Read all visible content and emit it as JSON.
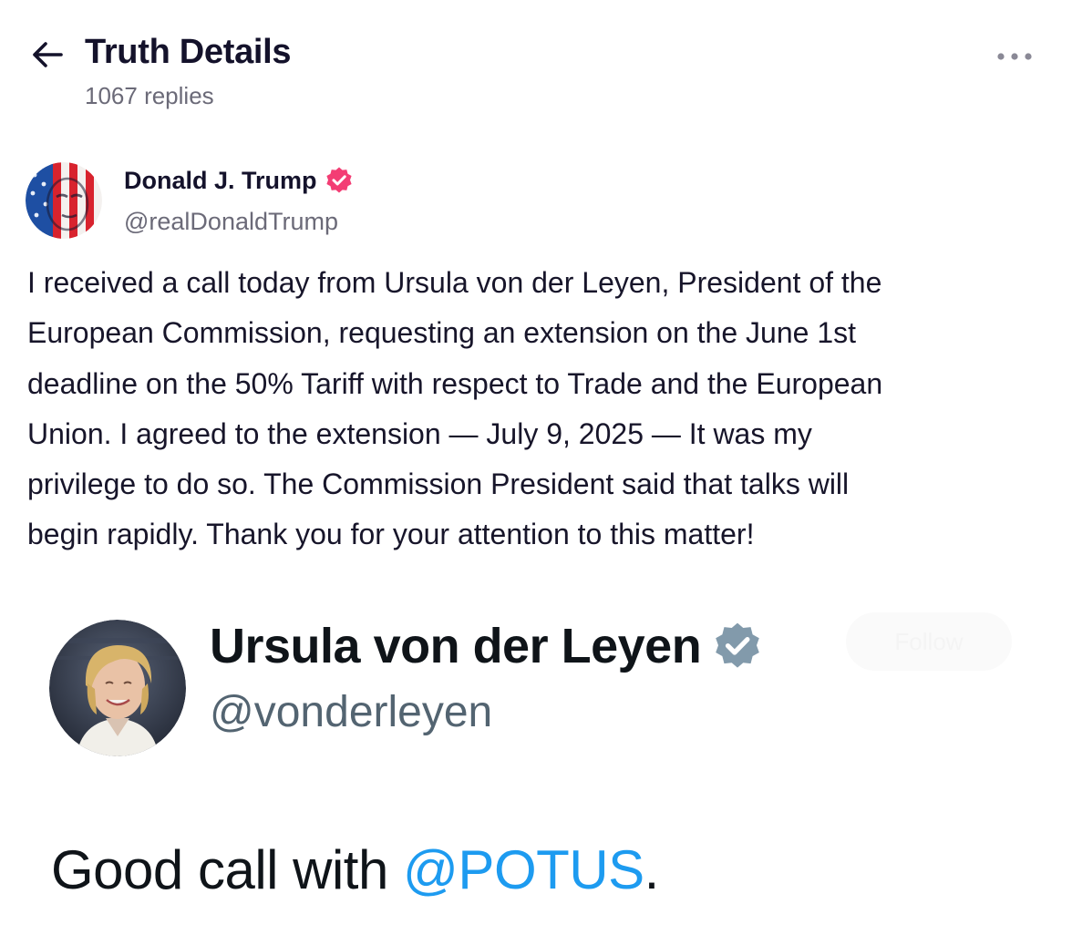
{
  "header": {
    "title": "Truth Details",
    "replies": "1067 replies",
    "back_icon": "arrow-left-icon",
    "more_icon": "more-horizontal-icon"
  },
  "post": {
    "author_name": "Donald J. Trump",
    "author_handle": "@realDonaldTrump",
    "verified_icon": "verified-badge-icon",
    "verified_color": "#f33d74",
    "body": "I received a call today from Ursula von der Leyen, President of the\nEuropean Commission, requesting an extension on the June 1st\ndeadline on the 50% Tariff with respect to Trade and the European\nUnion. I agreed to the extension — July 9, 2025 — It was my\nprivilege to do so. The Commission President said that talks will\nbegin rapidly. Thank you for your attention to this matter!"
  },
  "embed": {
    "name": "Ursula von der Leyen",
    "handle": "@vonderleyen",
    "verified_icon": "verified-badge-icon",
    "verified_color": "#829aab",
    "follow_label": "Follow",
    "text_prefix": "Good call with ",
    "mention": "@POTUS",
    "text_suffix": ".",
    "mention_color": "#1d9bf0"
  }
}
